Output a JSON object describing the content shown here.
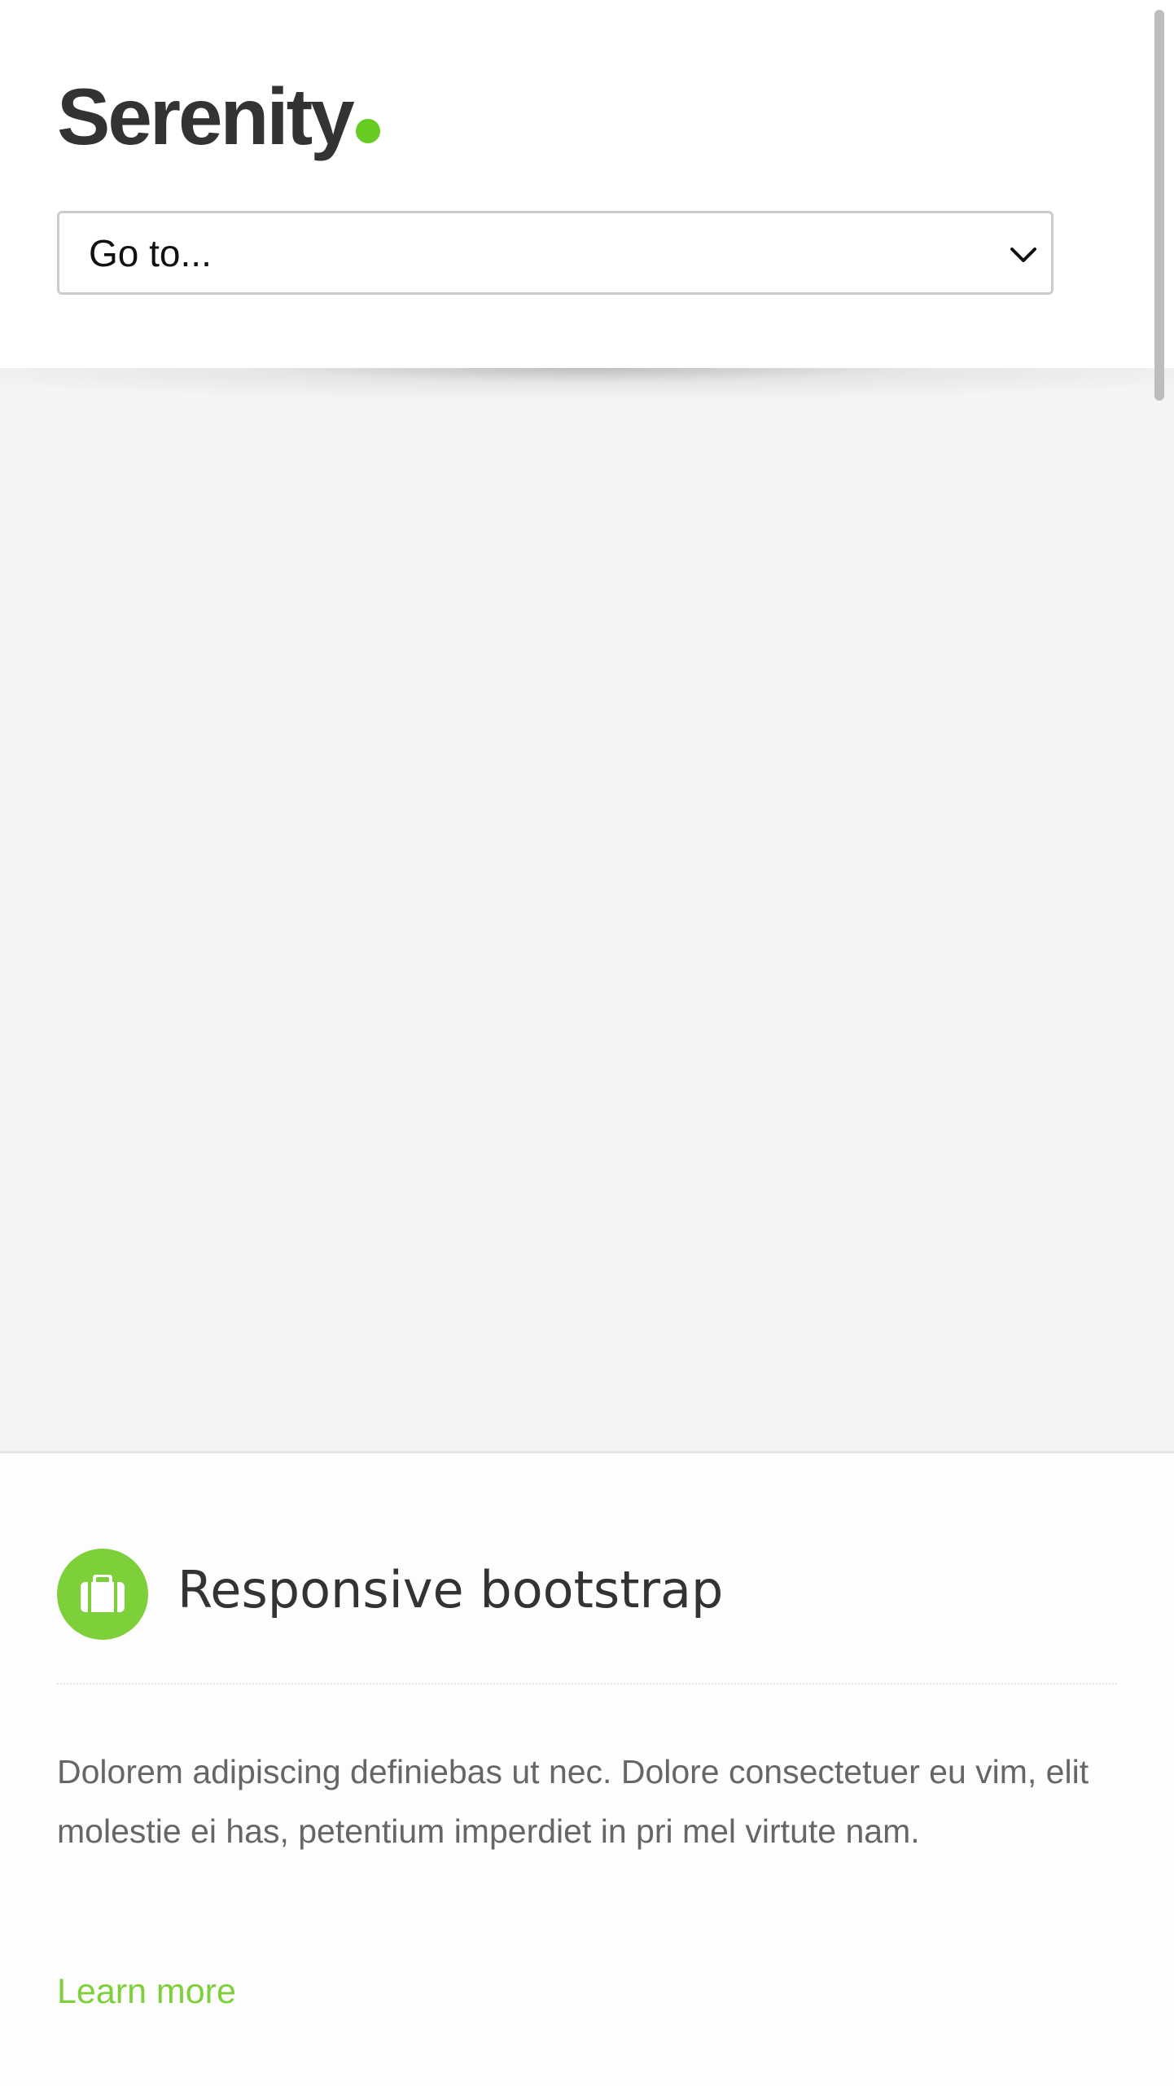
{
  "theme": {
    "accent": "#7ed03a",
    "logo_dot": "#66cc22",
    "hero_bg": "#f4f4f4",
    "text_dark": "#333333",
    "text_body": "#666666"
  },
  "header": {
    "logo_text": "Serenity",
    "nav_select": {
      "selected": "Go to...",
      "icon": "chevron-down-icon"
    }
  },
  "feature": {
    "icon": "briefcase-icon",
    "title": "Responsive bootstrap",
    "body": "Dolorem adipiscing definiebas ut nec. Dolore consectetuer eu vim, elit molestie ei has, petentium imperdiet in pri mel virtute nam.",
    "link_label": "Learn more"
  }
}
